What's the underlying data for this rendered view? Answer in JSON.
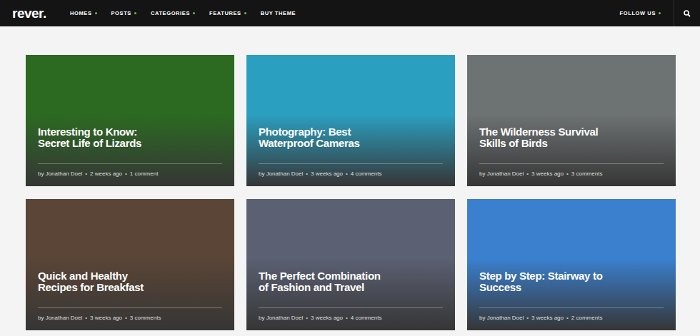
{
  "nav": {
    "logo": "rever.",
    "items": [
      {
        "label": "HOMES",
        "has_dropdown": true
      },
      {
        "label": "POSTS",
        "has_dropdown": true
      },
      {
        "label": "CATEGORIES",
        "has_dropdown": true
      },
      {
        "label": "FEATURES",
        "has_dropdown": true
      },
      {
        "label": "BUY THEME",
        "has_dropdown": false
      }
    ],
    "follow": {
      "label": "FOLLOW US",
      "has_dropdown": true
    }
  },
  "meta_separator": "•",
  "cards": [
    {
      "title_lines": [
        "Interesting to Know:",
        "Secret Life of Lizards"
      ],
      "author": "by Jonathan Doel",
      "time": "2 weeks ago",
      "comments": "1 comment",
      "color": "#2c6a22"
    },
    {
      "title_lines": [
        "Photography: Best",
        "Waterproof Cameras"
      ],
      "author": "by Jonathan Doel",
      "time": "3 weeks ago",
      "comments": "4 comments",
      "color": "#2b9fc0"
    },
    {
      "title_lines": [
        "The Wilderness Survival",
        "Skills of Birds"
      ],
      "author": "by Jonathan Doel",
      "time": "3 weeks ago",
      "comments": "3 comments",
      "color": "#6d7273"
    },
    {
      "title_lines": [
        "Quick and Healthy",
        "Recipes for Breakfast"
      ],
      "author": "by Jonathan Doel",
      "time": "3 weeks ago",
      "comments": "3 comments",
      "color": "#5a4536"
    },
    {
      "title_lines": [
        "The Perfect Combination",
        "of Fashion and Travel"
      ],
      "author": "by Jonathan Doel",
      "time": "3 weeks ago",
      "comments": "4 comments",
      "color": "#5b6072"
    },
    {
      "title_lines": [
        "Step by Step: Stairway to",
        "Success"
      ],
      "author": "by Jonathan Doel",
      "time": "3 weeks ago",
      "comments": "2 comments",
      "color": "#3a80cf"
    }
  ]
}
